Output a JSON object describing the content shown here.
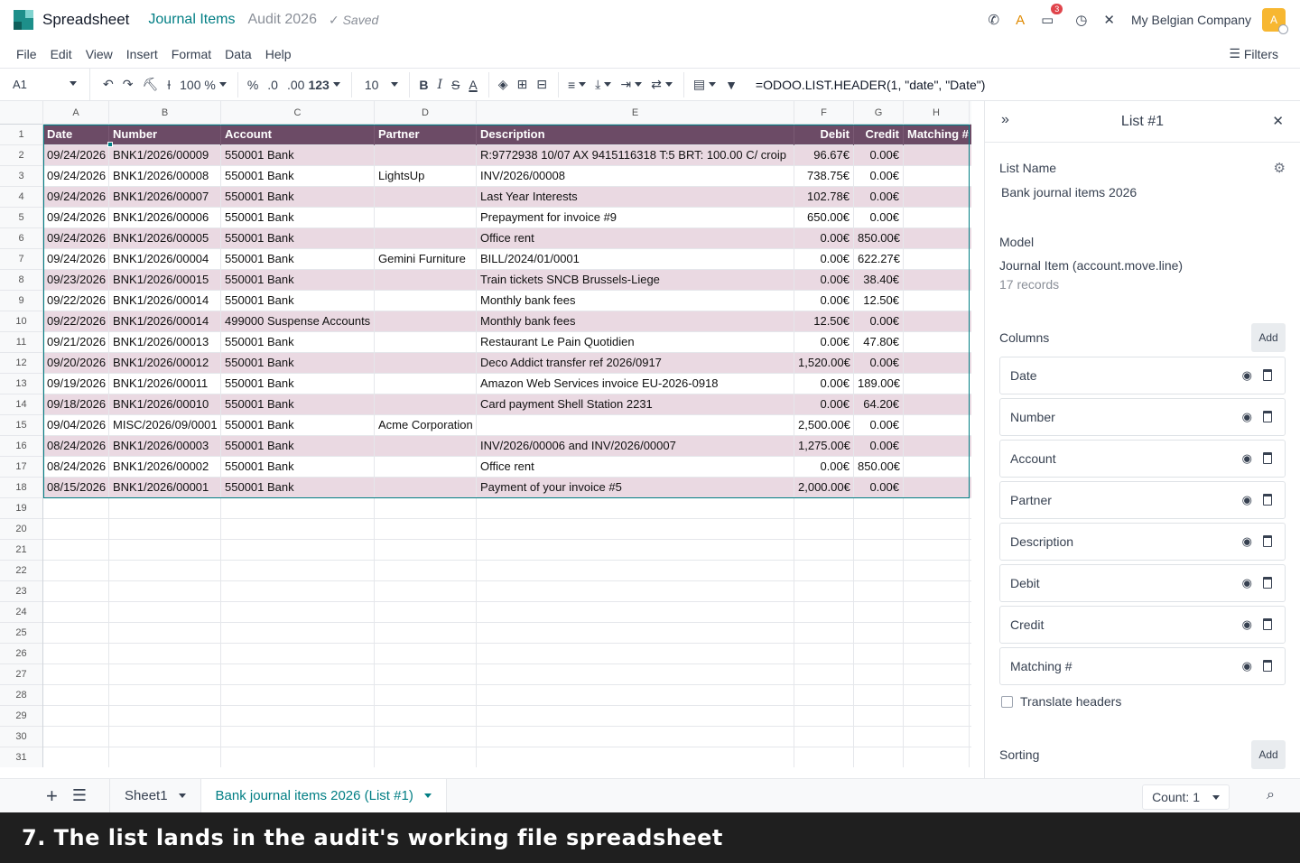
{
  "app": {
    "name": "Spreadsheet",
    "breadcrumb_1": "Journal Items",
    "breadcrumb_2": "Audit 2026",
    "saved": "Saved",
    "notification_count": "3",
    "company": "My Belgian Company",
    "avatar_letter": "A"
  },
  "menu": [
    "File",
    "Edit",
    "View",
    "Insert",
    "Format",
    "Data",
    "Help"
  ],
  "filters_label": "Filters",
  "toolbar": {
    "cell_ref": "A1",
    "zoom": "100 %",
    "percent": "%",
    "dec_less": ".0",
    "dec_more": ".00",
    "num_format": "123",
    "font_size": "10",
    "formula": "=ODOO.LIST.HEADER(1, \"date\", \"Date\")"
  },
  "grid": {
    "columns": [
      "A",
      "B",
      "C",
      "D",
      "E",
      "F",
      "G",
      "H"
    ],
    "header": [
      "Date",
      "Number",
      "Account",
      "Partner",
      "Description",
      "Debit",
      "Credit",
      "Matching #"
    ],
    "rows": [
      [
        "09/24/2026",
        "BNK1/2026/00009",
        "550001 Bank",
        "",
        "R:9772938  10/07 AX 9415116318 T:5 BRT: 100.00 C/ croip",
        "96.67€",
        "0.00€",
        ""
      ],
      [
        "09/24/2026",
        "BNK1/2026/00008",
        "550001 Bank",
        "LightsUp",
        "INV/2026/00008",
        "738.75€",
        "0.00€",
        ""
      ],
      [
        "09/24/2026",
        "BNK1/2026/00007",
        "550001 Bank",
        "",
        "Last Year Interests",
        "102.78€",
        "0.00€",
        ""
      ],
      [
        "09/24/2026",
        "BNK1/2026/00006",
        "550001 Bank",
        "",
        "Prepayment for invoice #9",
        "650.00€",
        "0.00€",
        ""
      ],
      [
        "09/24/2026",
        "BNK1/2026/00005",
        "550001 Bank",
        "",
        "Office rent",
        "0.00€",
        "850.00€",
        ""
      ],
      [
        "09/24/2026",
        "BNK1/2026/00004",
        "550001 Bank",
        "Gemini Furniture",
        "BILL/2024/01/0001",
        "0.00€",
        "622.27€",
        ""
      ],
      [
        "09/23/2026",
        "BNK1/2026/00015",
        "550001 Bank",
        "",
        "Train tickets SNCB Brussels-Liege",
        "0.00€",
        "38.40€",
        ""
      ],
      [
        "09/22/2026",
        "BNK1/2026/00014",
        "550001 Bank",
        "",
        "Monthly bank fees",
        "0.00€",
        "12.50€",
        ""
      ],
      [
        "09/22/2026",
        "BNK1/2026/00014",
        "499000 Suspense Accounts",
        "",
        "Monthly bank fees",
        "12.50€",
        "0.00€",
        ""
      ],
      [
        "09/21/2026",
        "BNK1/2026/00013",
        "550001 Bank",
        "",
        "Restaurant Le Pain Quotidien",
        "0.00€",
        "47.80€",
        ""
      ],
      [
        "09/20/2026",
        "BNK1/2026/00012",
        "550001 Bank",
        "",
        "Deco Addict transfer ref 2026/0917",
        "1,520.00€",
        "0.00€",
        ""
      ],
      [
        "09/19/2026",
        "BNK1/2026/00011",
        "550001 Bank",
        "",
        "Amazon Web Services invoice EU-2026-0918",
        "0.00€",
        "189.00€",
        ""
      ],
      [
        "09/18/2026",
        "BNK1/2026/00010",
        "550001 Bank",
        "",
        "Card payment Shell Station 2231",
        "0.00€",
        "64.20€",
        ""
      ],
      [
        "09/04/2026",
        "MISC/2026/09/0001",
        "550001 Bank",
        "Acme Corporation",
        "",
        "2,500.00€",
        "0.00€",
        ""
      ],
      [
        "08/24/2026",
        "BNK1/2026/00003",
        "550001 Bank",
        "",
        "INV/2026/00006 and INV/2026/00007",
        "1,275.00€",
        "0.00€",
        ""
      ],
      [
        "08/24/2026",
        "BNK1/2026/00002",
        "550001 Bank",
        "",
        "Office rent",
        "0.00€",
        "850.00€",
        ""
      ],
      [
        "08/15/2026",
        "BNK1/2026/00001",
        "550001 Bank",
        "",
        "Payment of your invoice #5",
        "2,000.00€",
        "0.00€",
        ""
      ]
    ],
    "row_numbers": [
      "1",
      "2",
      "3",
      "4",
      "5",
      "6",
      "7",
      "8",
      "9",
      "10",
      "11",
      "12",
      "13",
      "14",
      "15",
      "16",
      "17",
      "18",
      "19",
      "20",
      "21",
      "22",
      "23",
      "24",
      "25",
      "26",
      "27",
      "28",
      "29",
      "30",
      "31"
    ]
  },
  "panel": {
    "title": "List #1",
    "list_name_label": "List Name",
    "list_name": "Bank journal items 2026",
    "model_label": "Model",
    "model": "Journal Item (account.move.line)",
    "records": "17 records",
    "columns_label": "Columns",
    "add_label": "Add",
    "columns": [
      "Date",
      "Number",
      "Account",
      "Partner",
      "Description",
      "Debit",
      "Credit",
      "Matching #"
    ],
    "translate_label": "Translate headers",
    "sorting_label": "Sorting"
  },
  "sheets": [
    "Sheet1",
    "Bank journal items 2026 (List #1)"
  ],
  "count_label": "Count: 1",
  "caption": "7. The list lands in the audit's working file spreadsheet",
  "colors": {
    "accent": "#017e84",
    "header_row": "#6c4b66",
    "alt_row": "#ead9e2"
  }
}
